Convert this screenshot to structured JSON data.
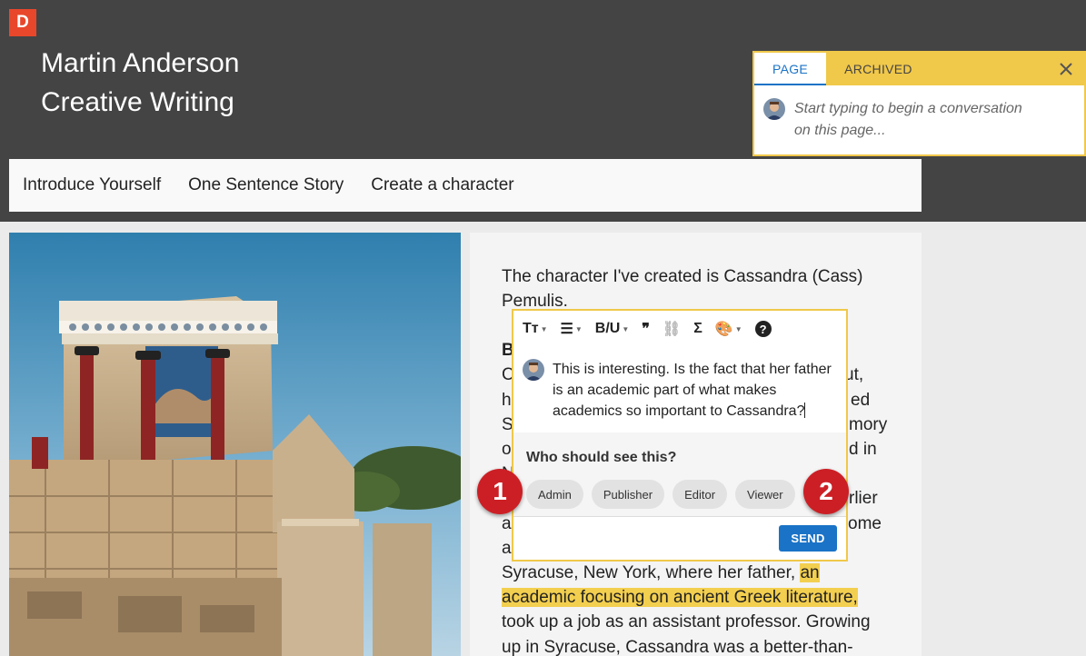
{
  "brand": {
    "logo_letter": "D",
    "logo_color": "#e8472b"
  },
  "site": {
    "title_line1": "Martin Anderson",
    "title_line2": "Creative Writing"
  },
  "nav": {
    "items": [
      {
        "label": "Introduce Yourself"
      },
      {
        "label": "One Sentence Story"
      },
      {
        "label": "Create a character"
      }
    ]
  },
  "article": {
    "lines": [
      "The character I've created is Cassandra (Cass)",
      "Pemulis.",
      "B",
      "C",
      "h",
      "S",
      "o",
      "N",
      "a",
      "a",
      "a",
      "Syracuse, New York, where her father,",
      "took up a job as an assistant professor. Growing",
      "up in Syracuse, Cassandra was a better-than-"
    ],
    "right_fragments": [
      "ut,",
      "ed",
      "mory",
      "d in",
      "rlier",
      "ome"
    ],
    "highlight_part1": "an",
    "highlight_part2": "academic focusing on ancient Greek literature,"
  },
  "comment_panel": {
    "tabs": [
      {
        "label": "PAGE"
      },
      {
        "label": "ARCHIVED"
      }
    ],
    "placeholder_line1": "Start typing to begin a conversation",
    "placeholder_line2": "on this page...",
    "close_icon": "close-icon"
  },
  "editor": {
    "toolbar": [
      {
        "label": "Tт",
        "icon": "text-size-icon"
      },
      {
        "label": "☰",
        "icon": "list-icon"
      },
      {
        "label": "B/U",
        "icon": "bold-underline-icon"
      },
      {
        "label": "❞",
        "icon": "quote-icon"
      },
      {
        "label": "⛓",
        "icon": "link-icon"
      },
      {
        "label": "Σ",
        "icon": "sum-icon"
      },
      {
        "label": "🎨",
        "icon": "palette-icon"
      },
      {
        "label": "?",
        "icon": "help-icon"
      }
    ],
    "comment_text": "This is interesting. Is the fact that her father is an academic part of what makes academics so important to Cassandra?",
    "visibility_question": "Who should see this?",
    "roles": [
      "Admin",
      "Publisher",
      "Editor",
      "Viewer"
    ],
    "add_label": "+",
    "send_label": "SEND"
  },
  "callouts": [
    "1",
    "2"
  ],
  "colors": {
    "header_bg": "#444444",
    "accent_blue": "#1a73c7",
    "highlight_yellow": "#f3cf4f",
    "marker_red": "#cc1f25"
  }
}
